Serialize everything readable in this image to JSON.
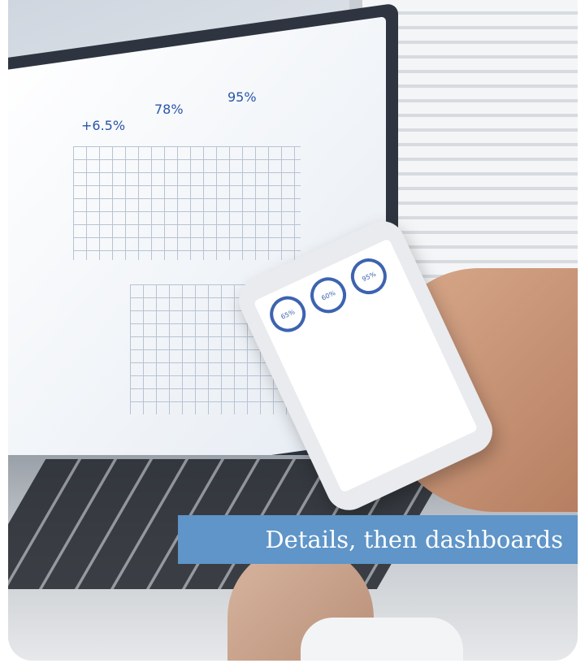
{
  "caption": {
    "text": "Details, then dashboards"
  },
  "photo": {
    "laptop_screen": {
      "kpis": [
        "+6.5%",
        "78%",
        "95%"
      ]
    },
    "phone_screen": {
      "rings": [
        "65%",
        "60%",
        "95%"
      ]
    }
  },
  "colors": {
    "caption_bg": "#5f95c8",
    "caption_text": "#ffffff",
    "chart_blue": "#2a56a8"
  }
}
